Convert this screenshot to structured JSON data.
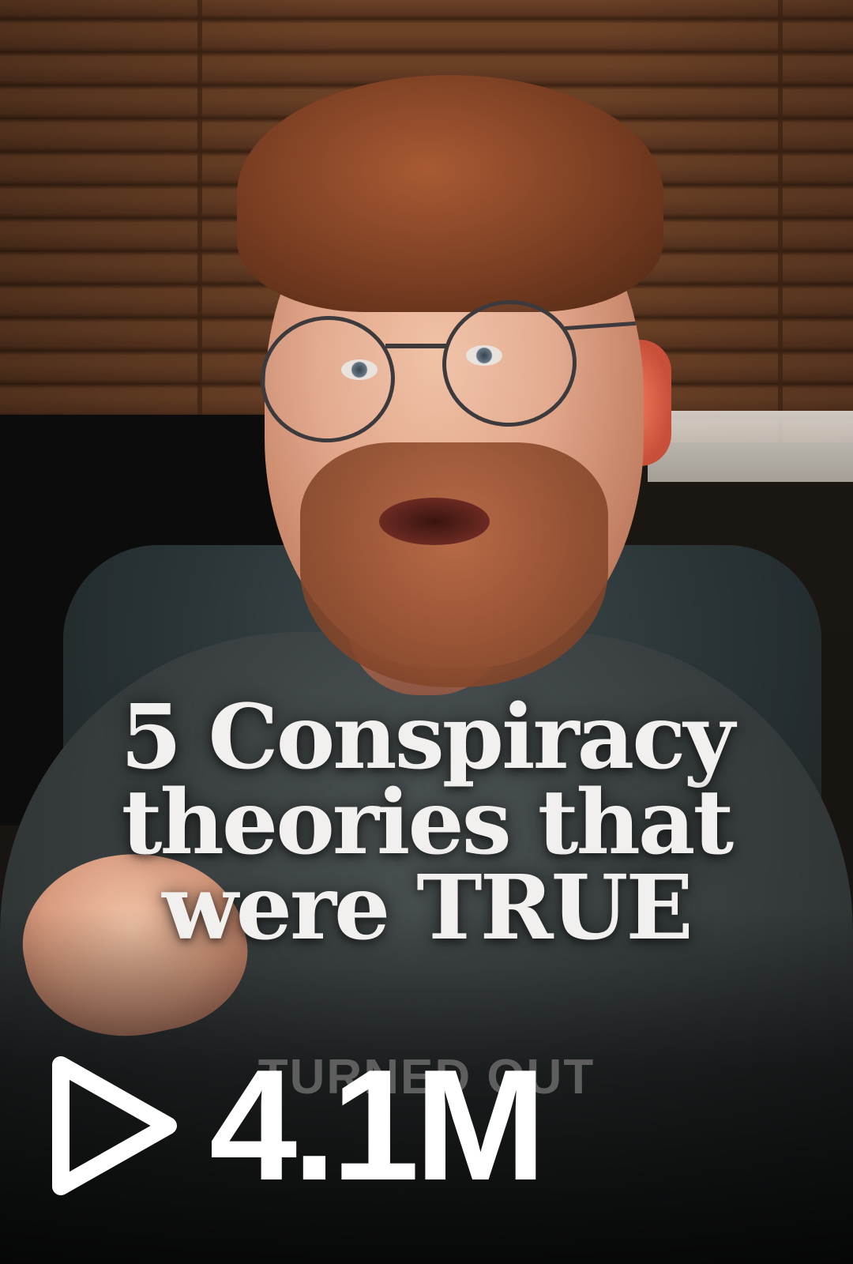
{
  "video": {
    "title_lines": [
      "5 Conspiracy",
      "theories that",
      "were TRUE"
    ],
    "subtitle": "TURNED OUT",
    "views": "4.1M",
    "view_icon": "play-icon"
  },
  "colors": {
    "title_text": "#f2f0ee",
    "views_text": "#ffffff",
    "background": "#1a120c"
  }
}
